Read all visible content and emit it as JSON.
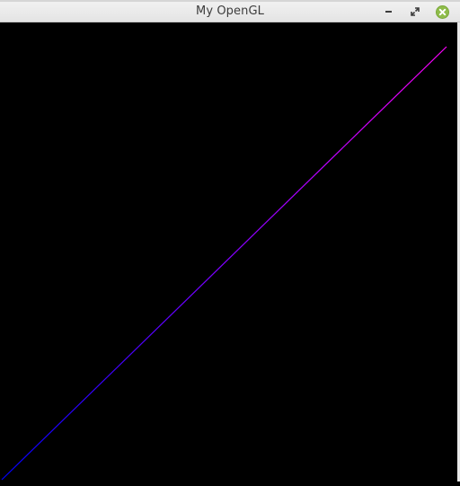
{
  "window": {
    "title": "My OpenGL",
    "controls": {
      "minimize": "minimize-icon",
      "maximize": "maximize-icon",
      "close": "close-icon"
    },
    "colors": {
      "titlebar": "#e8e8e8",
      "title_text": "#3c3c3c",
      "close_button": "#8fbc4a",
      "canvas_background": "#000000"
    }
  },
  "scene": {
    "line": {
      "start_color": "#0000ff",
      "end_color": "#ff00ff"
    }
  }
}
